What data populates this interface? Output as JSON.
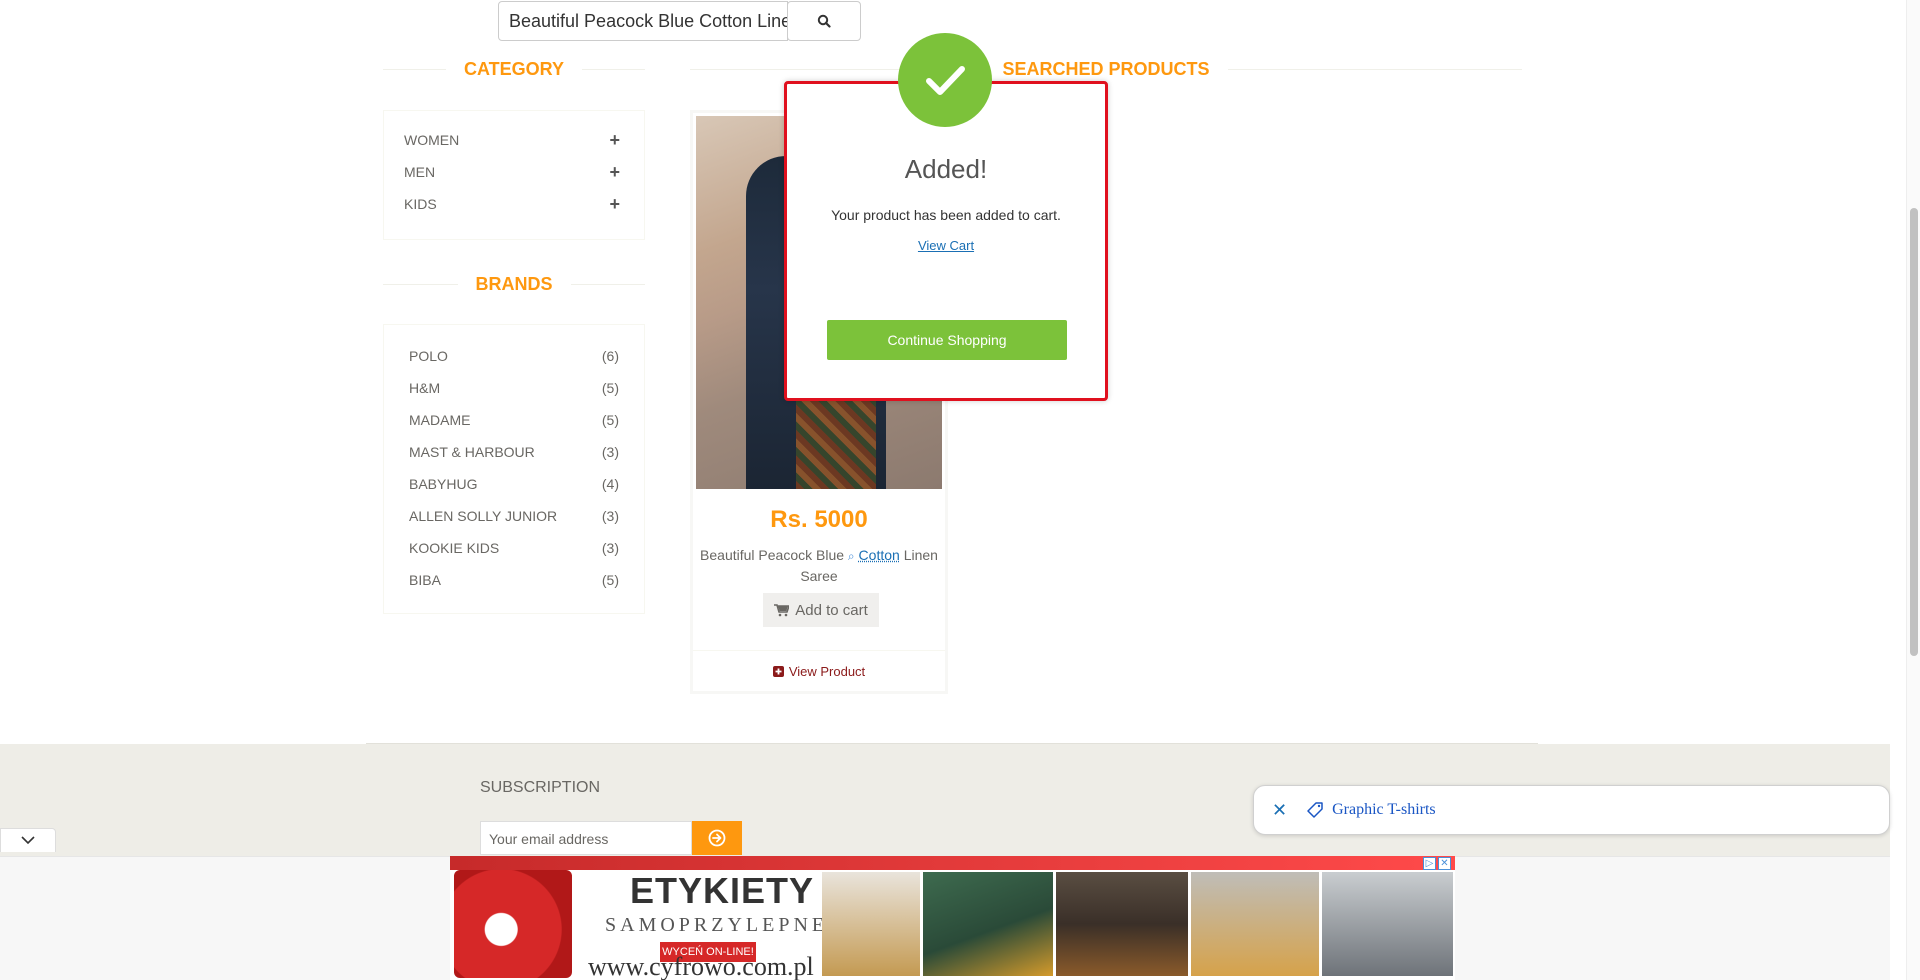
{
  "search": {
    "value": "Beautiful Peacock Blue Cotton Linen Saree"
  },
  "sidebar": {
    "category_heading": "Category",
    "categories": [
      {
        "label": "WOMEN",
        "expand": "+"
      },
      {
        "label": "MEN",
        "expand": "+"
      },
      {
        "label": "KIDS",
        "expand": "+"
      }
    ],
    "brands_heading": "Brands",
    "brands": [
      {
        "name": "POLO",
        "count": "(6)"
      },
      {
        "name": "H&M",
        "count": "(5)"
      },
      {
        "name": "MADAME",
        "count": "(5)"
      },
      {
        "name": "MAST & HARBOUR",
        "count": "(3)"
      },
      {
        "name": "BABYHUG",
        "count": "(4)"
      },
      {
        "name": "ALLEN SOLLY JUNIOR",
        "count": "(3)"
      },
      {
        "name": "KOOKIE KIDS",
        "count": "(3)"
      },
      {
        "name": "BIBA",
        "count": "(5)"
      }
    ]
  },
  "main": {
    "heading": "Searched Products",
    "product": {
      "price": "Rs. 5000",
      "name_part1": "Beautiful Peacock Blue",
      "name_link": "Cotton",
      "name_part2": "Linen Saree",
      "add_to_cart": "Add to cart",
      "view_product": "View Product"
    }
  },
  "modal": {
    "title": "Added!",
    "message": "Your product has been added to cart.",
    "link": "View Cart",
    "button": "Continue Shopping",
    "accent_color": "#7cc23a",
    "border_color": "#e0101e"
  },
  "footer": {
    "subscription_title": "Subscription",
    "email_placeholder": "Your email address"
  },
  "suggestion": {
    "label": "Graphic T-shirts"
  },
  "ad": {
    "title": "ETYKIETY",
    "subtitle": "SAMOPRZYLEPNE",
    "cta": "WYCEŃ ON-LINE!",
    "url": "www.cyfrowo.com.pl"
  },
  "colors": {
    "brand_orange": "#FE980F",
    "text_gray": "#696763",
    "footer_bg": "#eeede7"
  }
}
